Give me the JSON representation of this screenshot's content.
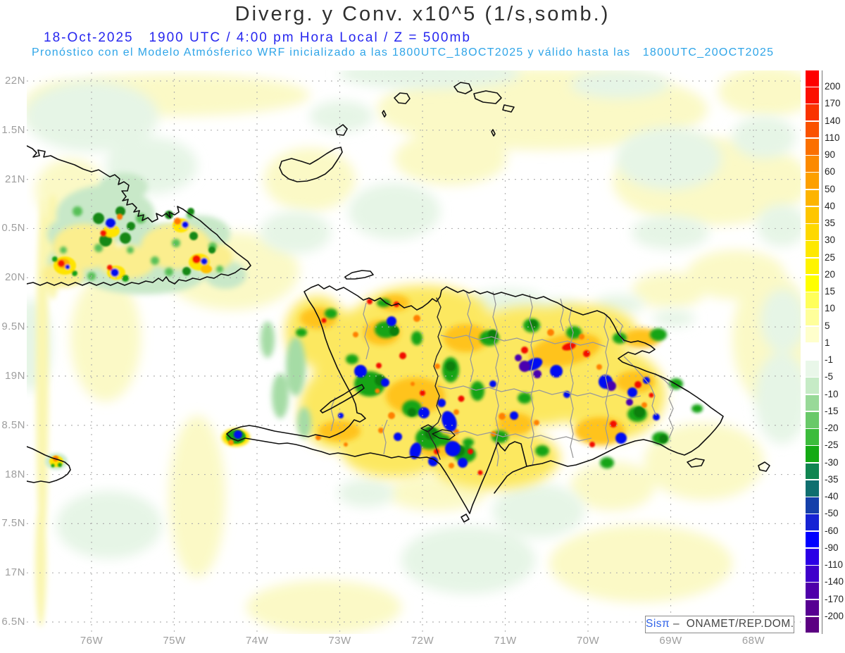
{
  "title": "Diverg. y Conv. x10^5 (1/s,somb.)",
  "subtitle_datetime": "18-Oct-2025   1900 UTC / 4:00 pm Hora Local / Z = 500mb",
  "subtitle_model": "Pronóstico con el Modelo Atmósferico WRF inicializado a las 1800UTC_18OCT2025 y válido hasta las   1800UTC_20OCT2025",
  "axes": {
    "lat_labels": [
      "22N",
      "1.5N",
      "21N",
      "0.5N",
      "20N",
      "9.5N",
      "19N",
      "8.5N",
      "18N",
      "7.5N",
      "17N",
      "6.5N"
    ],
    "lon_labels": [
      "76W",
      "75W",
      "74W",
      "73W",
      "72W",
      "71W",
      "70W",
      "69W",
      "68W"
    ]
  },
  "colorbar": {
    "tick_labels": [
      "200",
      "170",
      "140",
      "110",
      "90",
      "60",
      "50",
      "40",
      "35",
      "30",
      "25",
      "20",
      "15",
      "10",
      "5",
      "1",
      "-1",
      "-5",
      "-10",
      "-15",
      "-20",
      "-25",
      "-30",
      "-35",
      "-40",
      "-50",
      "-60",
      "-90",
      "-110",
      "-140",
      "-170",
      "-200"
    ],
    "cell_colors": [
      "#FE0000",
      "#FC1000",
      "#FA3300",
      "#FA5200",
      "#FB7000",
      "#FC8A00",
      "#FDA000",
      "#FDB400",
      "#FEC600",
      "#FED800",
      "#FEE800",
      "#FFF400",
      "#FFFF00",
      "#FFFF5A",
      "#FFFF9B",
      "#FFFFCC",
      "#FFFFFF",
      "#E9F7E9",
      "#C6EBC6",
      "#98D998",
      "#69C969",
      "#3CBC3C",
      "#14AA14",
      "#108551",
      "#0F6F6F",
      "#1540AA",
      "#1623D4",
      "#0000FF",
      "#2B00E6",
      "#3F00CB",
      "#4F00AA",
      "#570092",
      "#5C0082"
    ]
  },
  "attribution": {
    "brand": "Sisπ",
    "text": " –  ONAMET/REP.DOM."
  }
}
